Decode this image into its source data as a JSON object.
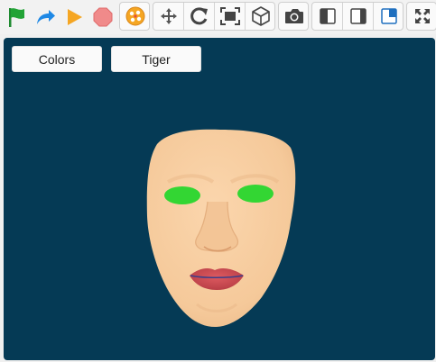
{
  "toolbar": {
    "icons": [
      "green-flag",
      "redo-arrow",
      "play",
      "stop",
      "texture-ball",
      "move",
      "rotate",
      "fit-frame",
      "cube",
      "camera",
      "split-left",
      "split-right",
      "split-corner",
      "fullscreen"
    ],
    "colors": {
      "flag": "#22a336",
      "redo": "#1e88e5",
      "play": "#f5a623",
      "stop": "#f08a8a",
      "icon_gray": "#444444"
    }
  },
  "viewport": {
    "background": "#053a55",
    "buttons": {
      "colors_label": "Colors",
      "tiger_label": "Tiger"
    },
    "model": {
      "skin": "#f7cfa3",
      "eyes": "#33d633",
      "lips": "#c9474e"
    }
  }
}
